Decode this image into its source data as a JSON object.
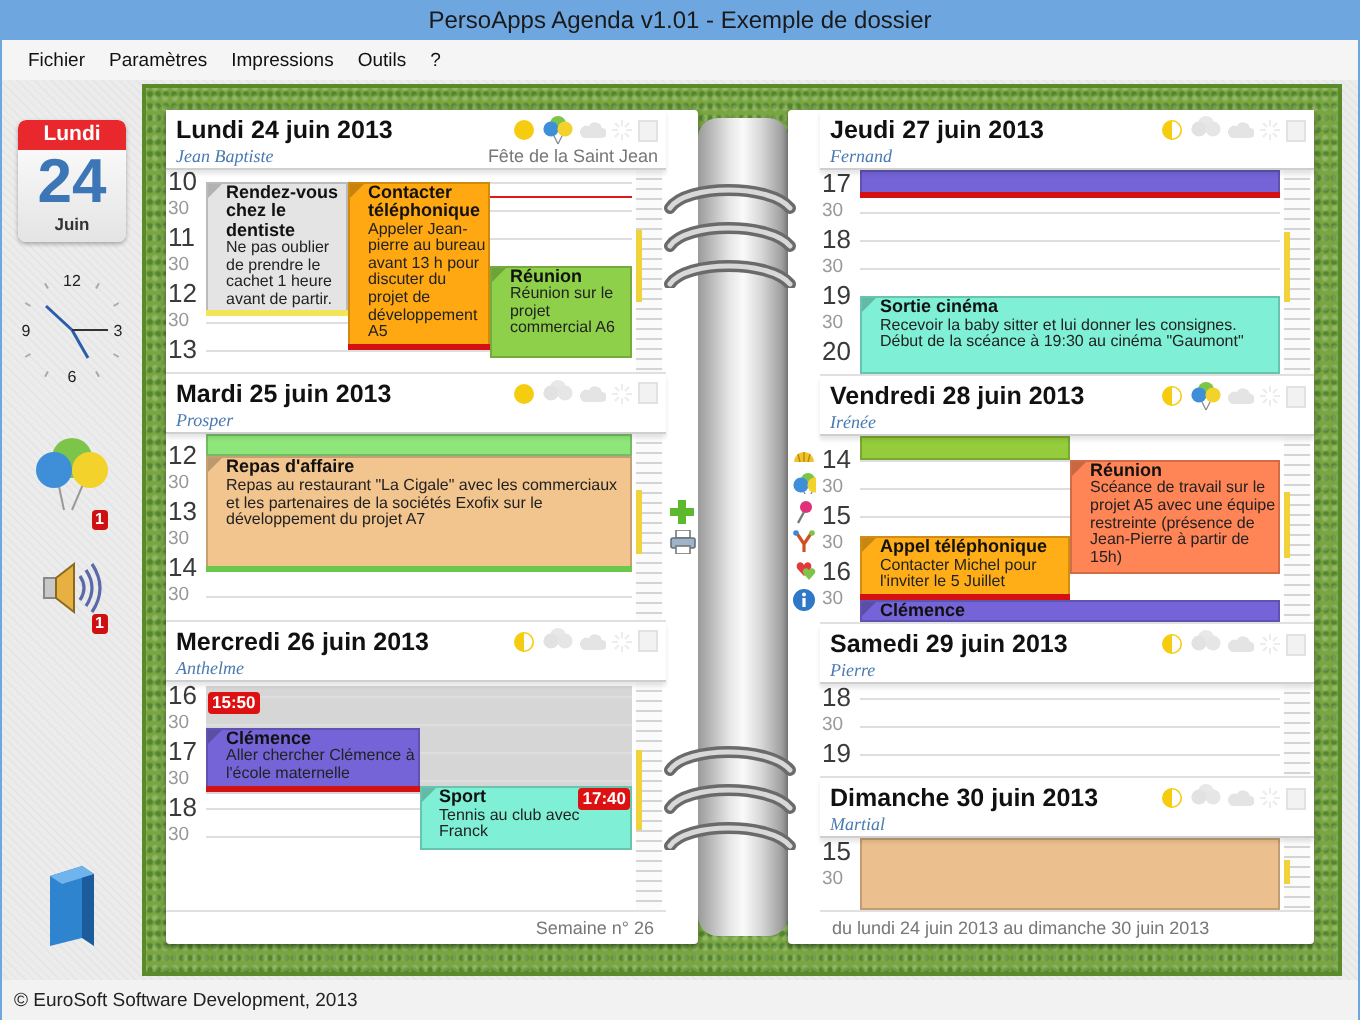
{
  "window": {
    "title": "PersoApps Agenda v1.01 - Exemple de dossier"
  },
  "menu": [
    "Fichier",
    "Paramètres",
    "Impressions",
    "Outils",
    "?"
  ],
  "sidebar": {
    "calendar": {
      "weekday": "Lundi",
      "day": "24",
      "month": "Juin"
    },
    "clock": {
      "numbers": [
        "12",
        "3",
        "6",
        "9"
      ]
    },
    "birthdays": {
      "badge": "1"
    },
    "alerts": {
      "badge": "1"
    }
  },
  "left_page": {
    "days": [
      {
        "title": "Lundi 24 juin 2013",
        "saint": "Jean Baptiste",
        "feast": "Fête de la Saint Jean",
        "full_moon": true,
        "birthday": true,
        "labels": [
          "10",
          "30",
          "11",
          "30",
          "12",
          "30",
          "13"
        ],
        "events": [
          {
            "title": "Rendez-vous chez le dentiste",
            "text": "Ne pas oublier de prendre le cachet 1 heure avant de partir.",
            "color": "#e4e4e4"
          },
          {
            "title": "Contacter téléphonique",
            "text": "Appeler Jean-pierre au bureau avant 13 h pour discuter du projet de développement A5",
            "color": "#ffa812"
          },
          {
            "title": "Réunion",
            "text": "Réunion sur le projet commercial A6",
            "color": "#8fd04a"
          }
        ]
      },
      {
        "title": "Mardi 25 juin 2013",
        "saint": "Prosper",
        "full_moon": true,
        "birthday": false,
        "labels": [
          "12",
          "30",
          "13",
          "30",
          "14",
          "30"
        ],
        "events": [
          {
            "color": "#8ee67a"
          },
          {
            "title": "Repas d'affaire",
            "text": "Repas au restaurant \"La Cigale\" avec les commerciaux et les partenaires de la sociétés Exofix sur le développement du projet A7",
            "color": "#f2c48e"
          }
        ]
      },
      {
        "title": "Mercredi 26 juin 2013",
        "saint": "Anthelme",
        "full_moon": false,
        "birthday": false,
        "labels": [
          "16",
          "30",
          "17",
          "30",
          "18",
          "30"
        ],
        "busy": {
          "label": "15:50"
        },
        "events": [
          {
            "title": "Clémence",
            "text": "Aller chercher Clémence à l'école maternelle",
            "color": "#7464d8"
          },
          {
            "title": "Sport",
            "text": "Tennis au club avec Franck",
            "color": "#7ff0d6",
            "time_badge": "17:40"
          }
        ]
      }
    ],
    "footer": "Semaine n° 26"
  },
  "right_page": {
    "days": [
      {
        "title": "Jeudi 27 juin 2013",
        "saint": "Fernand",
        "full_moon": false,
        "birthday": false,
        "labels": [
          "17",
          "30",
          "18",
          "30",
          "19",
          "30",
          "20"
        ],
        "events": [
          {
            "color": "#7464d8"
          },
          {
            "title": "Sortie cinéma",
            "text": "Recevoir la baby sitter et lui donner les consignes. Début de la scéance à 19:30 au cinéma \"Gaumont\"",
            "color": "#7ff0d6"
          }
        ]
      },
      {
        "title": "Vendredi 28 juin 2013",
        "saint": "Irénée",
        "full_moon": false,
        "birthday": true,
        "labels": [
          "14",
          "30",
          "15",
          "30",
          "16",
          "30"
        ],
        "events": [
          {
            "color": "#94cc3c"
          },
          {
            "title": "Réunion",
            "text": "Scéance de travail sur le projet A5 avec une équipe restreinte (présence de Jean-Pierre à partir de 15h)",
            "color": "#ff8456"
          },
          {
            "title": "Appel téléphonique",
            "text": "Contacter Michel pour l'inviter le 5 Juillet",
            "color": "#ffae18"
          },
          {
            "title": "Clémence",
            "color": "#7464d8"
          }
        ]
      },
      {
        "title": "Samedi 29 juin 2013",
        "saint": "Pierre",
        "full_moon": false,
        "birthday": false,
        "labels": [
          "18",
          "30",
          "19"
        ]
      },
      {
        "title": "Dimanche 30 juin 2013",
        "saint": "Martial",
        "full_moon": false,
        "birthday": false,
        "labels": [
          "15",
          "30"
        ],
        "events": [
          {
            "color": "#ecc08e"
          }
        ]
      }
    ],
    "footer": "du lundi 24 juin 2013 au dimanche 30 juin 2013"
  },
  "status_bar": "© EuroSoft Software Development, 2013"
}
